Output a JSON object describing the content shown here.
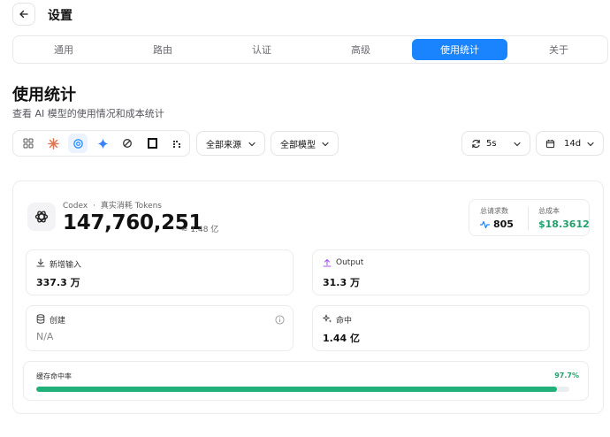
{
  "header": {
    "title": "设置",
    "back_icon": "arrow-left-icon"
  },
  "tabs": [
    {
      "label": "通用",
      "active": false
    },
    {
      "label": "路由",
      "active": false
    },
    {
      "label": "认证",
      "active": false
    },
    {
      "label": "高级",
      "active": false
    },
    {
      "label": "使用统计",
      "active": true
    },
    {
      "label": "关于",
      "active": false
    }
  ],
  "section": {
    "title": "使用统计",
    "subtitle": "查看 AI 模型的使用情况和成本统计"
  },
  "providers": [
    {
      "icon": "grid-icon",
      "active": false
    },
    {
      "icon": "claude-icon",
      "active": false
    },
    {
      "icon": "openai-icon",
      "active": true
    },
    {
      "icon": "gemini-icon",
      "active": false
    },
    {
      "icon": "refresh-provider-icon",
      "active": false
    },
    {
      "icon": "square-provider-icon",
      "active": false
    },
    {
      "icon": "pi-provider-icon",
      "active": false
    }
  ],
  "filters": {
    "source": "全部来源",
    "model": "全部模型",
    "refresh_interval": "5s",
    "range": "14d"
  },
  "stats": {
    "provider_name": "Codex",
    "separator": "·",
    "tokens_label": "真实消耗 Tokens",
    "total_tokens": "147,760,251",
    "approx": "≈ 1.48 亿",
    "requests_label": "总请求数",
    "requests_value": "805",
    "cost_label": "总成本",
    "cost_value": "$18.3612",
    "cost_color": "#22a06b",
    "input_label": "新增输入",
    "input_value": "337.3 万",
    "output_label": "Output",
    "output_value": "31.3 万",
    "create_label": "创建",
    "create_value": "N/A",
    "hit_label": "命中",
    "hit_value": "1.44 亿",
    "hit_rate_label": "缓存命中率",
    "hit_rate_value": "97.7%",
    "hit_rate": 0.977
  },
  "colors": {
    "accent": "#1a84ff",
    "success": "#22b07a"
  }
}
